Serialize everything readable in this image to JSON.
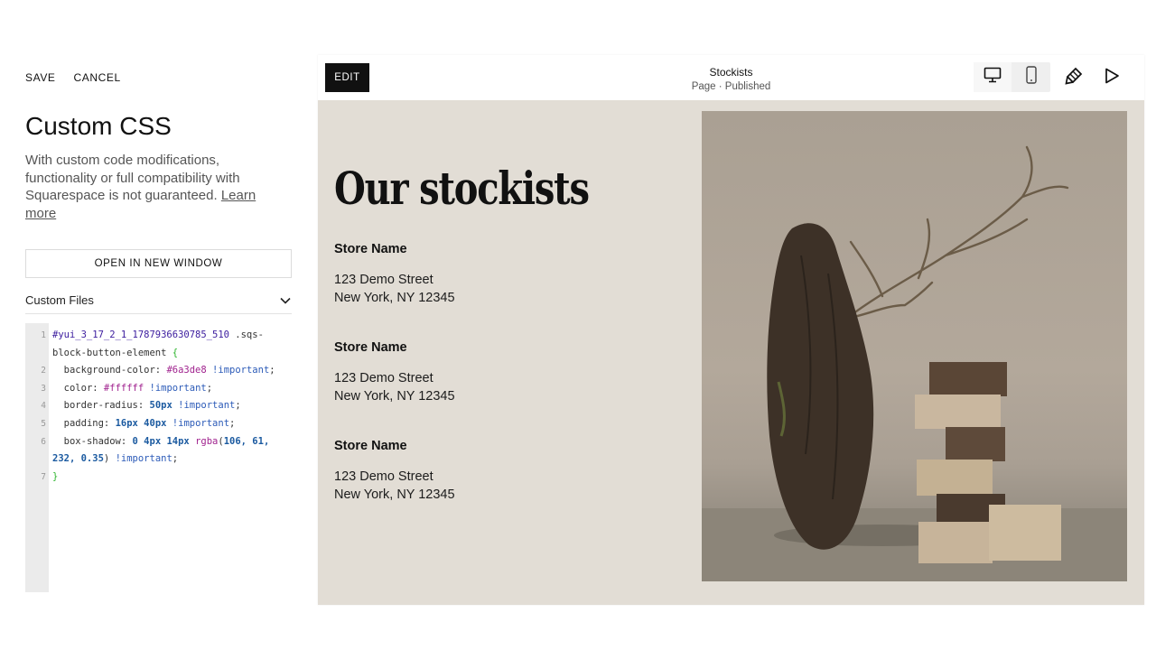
{
  "toolbar": {
    "save_label": "SAVE",
    "cancel_label": "CANCEL"
  },
  "panel": {
    "title": "Custom CSS",
    "description": "With custom code modifications, functionality or full compatibility with Squarespace is not guaranteed.",
    "learn_more_label": "Learn more",
    "open_window_label": "OPEN IN NEW WINDOW",
    "custom_files_label": "Custom Files"
  },
  "code": {
    "selector": "#yui_3_17_2_1_1787936630785_510",
    "selector_class": " .sqs-block-button-element",
    "open_brace": "{",
    "close_brace": "}",
    "important": "!important",
    "prop_bg": "background-color:",
    "val_bg": "#6a3de8",
    "prop_color": "color:",
    "val_color": "#ffffff",
    "prop_radius": "border-radius:",
    "val_radius": "50px",
    "prop_padding": "padding:",
    "val_padding": "16px 40px",
    "prop_shadow": "box-shadow:",
    "val_shadow_nums": "0 4px 14px",
    "val_shadow_fn": "rgba",
    "val_shadow_args": "106, 61, 232, 0.35",
    "line_numbers": [
      "1",
      "2",
      "3",
      "4",
      "5",
      "6",
      "7"
    ]
  },
  "preview": {
    "edit_label": "EDIT",
    "page_title": "Stockists",
    "page_status": "Page · Published",
    "heading": "Our stockists",
    "stores": [
      {
        "name": "Store Name",
        "street": "123 Demo Street",
        "city": "New York, NY 12345"
      },
      {
        "name": "Store Name",
        "street": "123 Demo Street",
        "city": "New York, NY 12345"
      },
      {
        "name": "Store Name",
        "street": "123 Demo Street",
        "city": "New York, NY 12345"
      }
    ],
    "active_device": "desktop"
  },
  "colors": {
    "accent": "#111111",
    "preview_bg": "#e2ddd5",
    "editor_gutter": "#ebebeb"
  },
  "icons": {
    "desktop": "desktop-icon",
    "mobile": "mobile-icon",
    "style": "paintbrush-icon",
    "preview": "play-icon",
    "files_toggle": "chevron-down-icon"
  }
}
